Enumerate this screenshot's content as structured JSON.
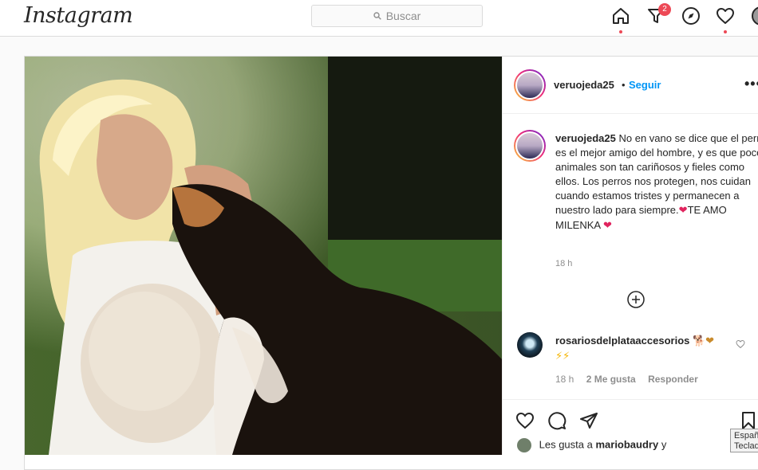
{
  "header": {
    "logo": "Instagram",
    "search_placeholder": "Buscar",
    "notification_count": "2"
  },
  "post": {
    "owner": {
      "username": "veruojeda25",
      "separator": "•",
      "follow_label": "Seguir"
    },
    "caption": {
      "username": "veruojeda25",
      "text": "No en vano se dice que el perro es el mejor amigo del hombre, y es que pocos animales son tan cariñosos y fieles como ellos. Los perros nos protegen, nos cuidan cuando estamos tristes y permanecen a nuestro lado para siempre.",
      "text2": "TE AMO MILENKA",
      "heart_emoji": "❤",
      "time": "18 h"
    },
    "comment": {
      "username": "rosariosdelplataaccesorios",
      "emojis": "🐕❤",
      "emojis2": "⚡⚡",
      "time": "18 h",
      "likes": "2 Me gusta",
      "reply": "Responder"
    },
    "likes": {
      "prefix": "Les gusta a",
      "user": "mariobaudry",
      "suffix": "y"
    }
  },
  "keyboard_tooltip": {
    "line1": "Españ",
    "line2": "Teclad"
  },
  "colors": {
    "accent": "#0095f6",
    "notification": "#ed4956",
    "border": "#dbdbdb"
  }
}
